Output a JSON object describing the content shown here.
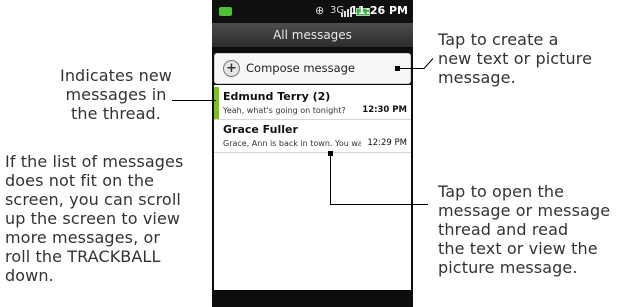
{
  "statusbar": {
    "time": "11:26 PM",
    "gps_glyph": "⊕",
    "network_glyph": "3G"
  },
  "titlebar": {
    "title": "All messages"
  },
  "compose": {
    "icon": "+",
    "label": "Compose message"
  },
  "threads": [
    {
      "sender": "Edmund Terry (2)",
      "snippet": "Yeah, what's going on tonight?",
      "time": "12:30 PM",
      "unread": true
    },
    {
      "sender": "Grace Fuller",
      "snippet": "Grace, Ann is back in town. You wan",
      "time": "12:29 PM",
      "unread": false
    }
  ],
  "callouts": {
    "new_messages": [
      "Indicates new",
      "messages in",
      "the thread."
    ],
    "scroll": [
      "If the list of messages",
      "does not fit on the",
      "screen, you can scroll",
      "up the screen to view",
      "more messages, or",
      "roll the TRACKBALL",
      "down."
    ],
    "compose": [
      "Tap to create a",
      "new text or picture",
      "message."
    ],
    "open": [
      "Tap to open the",
      "message or message",
      "thread and read",
      "the text or view the",
      "picture message."
    ]
  },
  "colors": {
    "unread_indicator": "#79c314",
    "titlebar": "#3a3a3a",
    "phone_frame": "#0d0d0d"
  }
}
